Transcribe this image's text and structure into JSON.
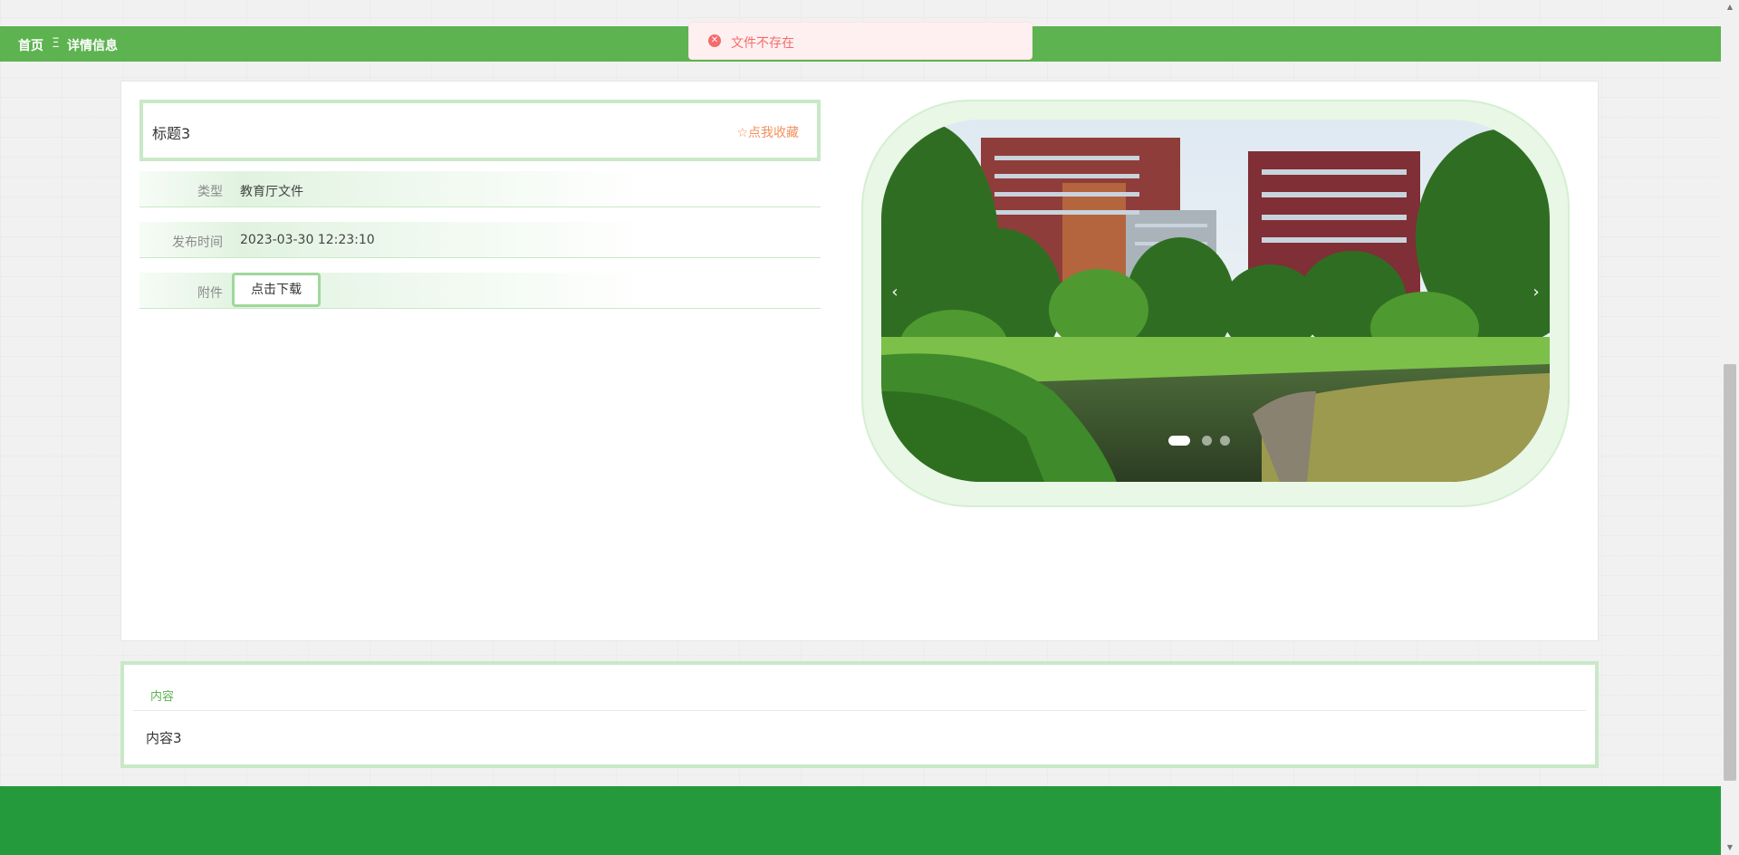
{
  "breadcrumb": {
    "home": "首页",
    "separator": "Ξ",
    "current": "详情信息"
  },
  "toast": {
    "icon": "error-circle-icon",
    "message": "文件不存在",
    "color": "#f56c6c"
  },
  "detail": {
    "title": "标题3",
    "collect_label": "☆点我收藏",
    "fields": [
      {
        "label": "类型",
        "value": "教育厅文件"
      },
      {
        "label": "发布时间",
        "value": "2023-03-30 12:23:10"
      },
      {
        "label": "附件",
        "button_label": "点击下载"
      }
    ]
  },
  "carousel": {
    "prev_label": "‹",
    "next_label": "›",
    "slide_count": 3,
    "active_index": 0
  },
  "content": {
    "tab_label": "内容",
    "body": "内容3"
  },
  "colors": {
    "accent": "#5cb34f",
    "footer": "#259a3d",
    "border_light": "#c8e9c6",
    "collect": "#f0915d"
  }
}
